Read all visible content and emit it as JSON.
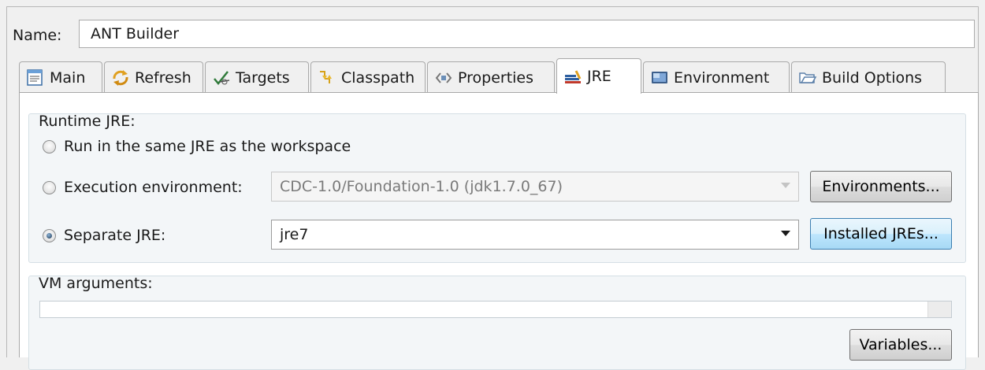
{
  "name_field": {
    "label": "Name:",
    "value": "ANT Builder"
  },
  "tabs": [
    {
      "label": "Main",
      "icon": "main-tab-icon"
    },
    {
      "label": "Refresh",
      "icon": "refresh-icon"
    },
    {
      "label": "Targets",
      "icon": "targets-icon"
    },
    {
      "label": "Classpath",
      "icon": "classpath-icon"
    },
    {
      "label": "Properties",
      "icon": "properties-icon"
    },
    {
      "label": "JRE",
      "icon": "jre-icon",
      "active": true
    },
    {
      "label": "Environment",
      "icon": "environment-icon"
    },
    {
      "label": "Build Options",
      "icon": "folder-icon"
    }
  ],
  "runtime_jre": {
    "group_label": "Runtime JRE:",
    "option_workspace": "Run in the same JRE as the workspace",
    "option_execution_env": "Execution environment:",
    "execution_env_value": "CDC-1.0/Foundation-1.0 (jdk1.7.0_67)",
    "environments_button": "Environments...",
    "option_separate_jre": "Separate JRE:",
    "separate_jre_value": "jre7",
    "installed_jres_button": "Installed JREs...",
    "selected": "separate_jre"
  },
  "vm_arguments": {
    "group_label": "VM arguments:",
    "value": "",
    "variables_button": "Variables..."
  }
}
